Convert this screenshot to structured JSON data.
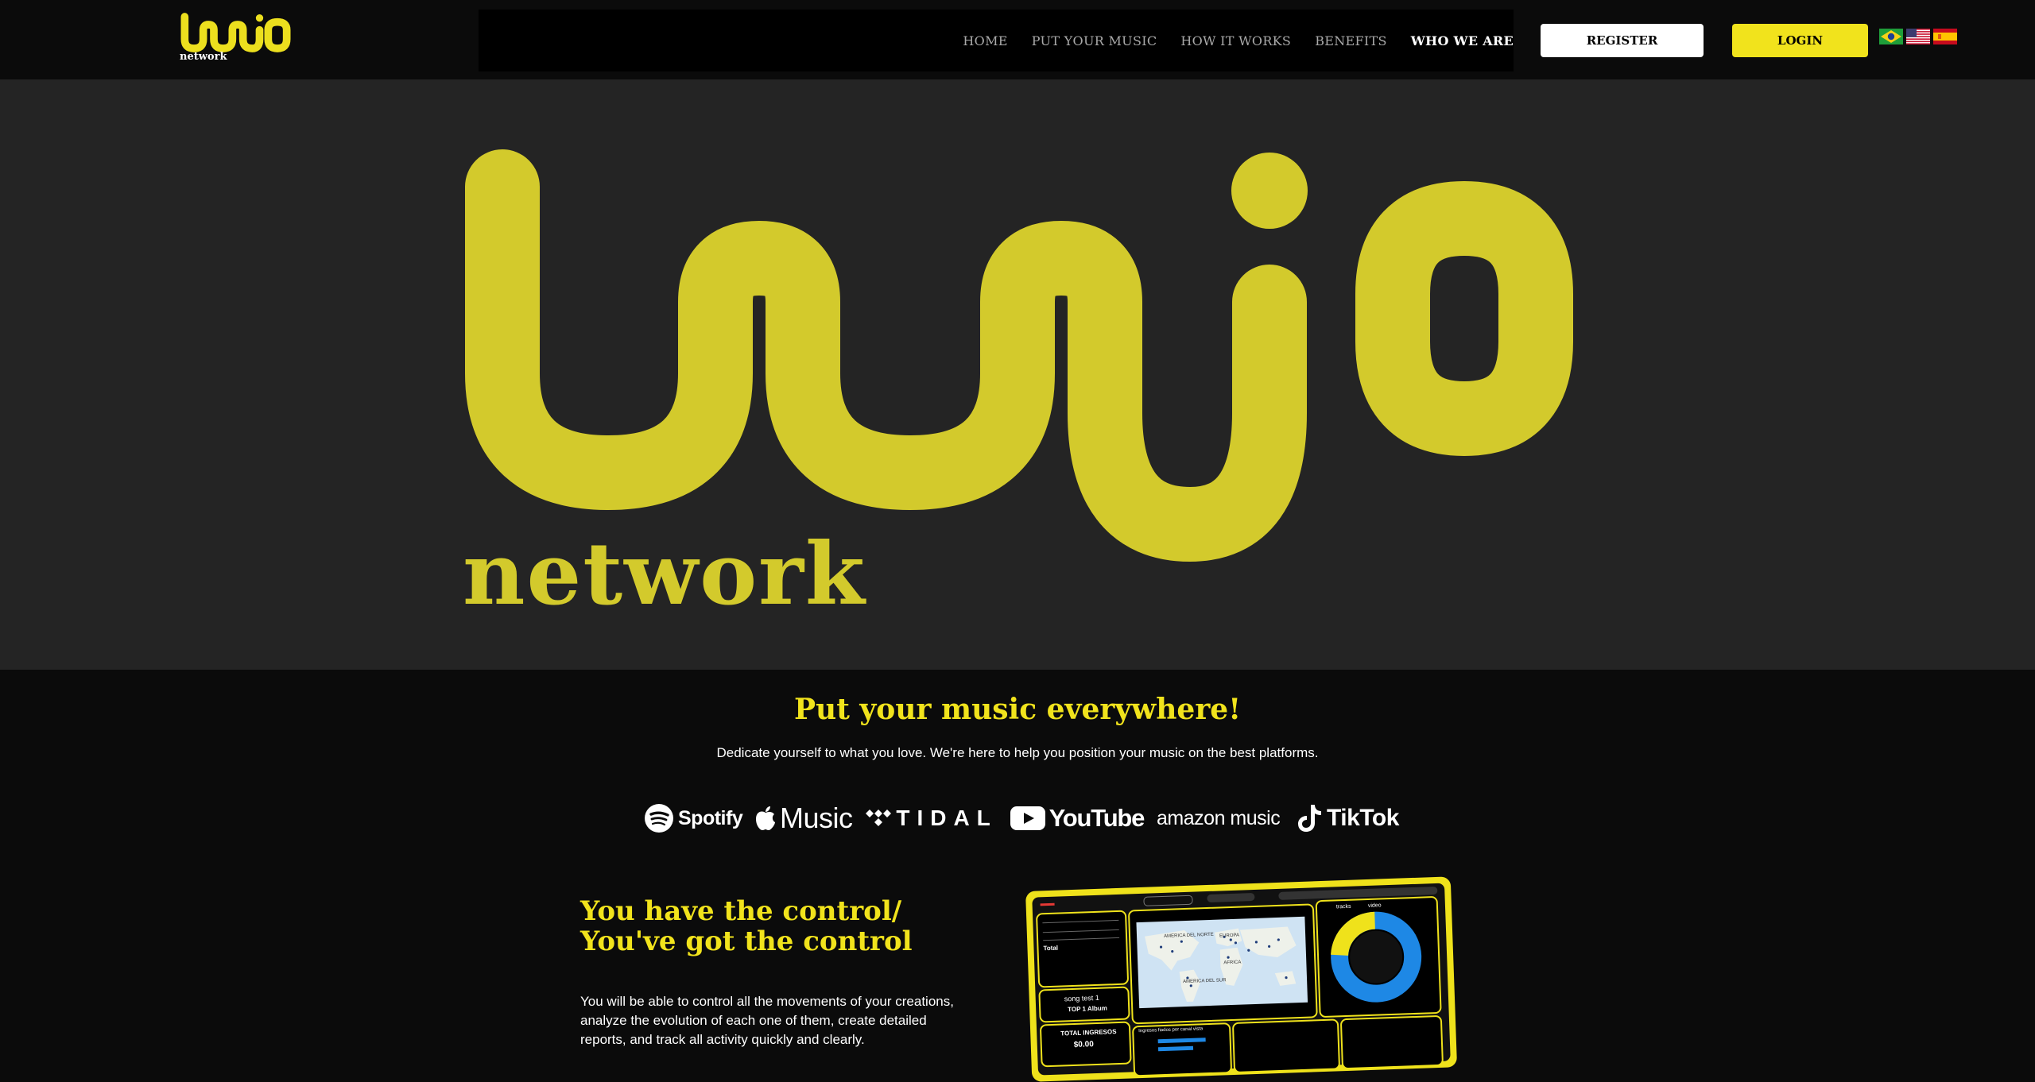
{
  "header": {
    "logo_text": "network",
    "nav": [
      "HOME",
      "PUT YOUR MUSIC",
      "HOW IT WORKS",
      "BENEFITS",
      "WHO WE ARE"
    ],
    "active_nav": "WHO WE ARE",
    "register_label": "REGISTER",
    "login_label": "LOGIN",
    "languages": [
      "brazil-flag-icon",
      "usa-flag-icon",
      "spain-flag-icon"
    ]
  },
  "hero": {
    "logo_word": "network",
    "colors": {
      "logo": "#d3ca2c",
      "background": "#242424"
    }
  },
  "platforms_section": {
    "title": "Put your music everywhere!",
    "subtitle": "Dedicate yourself to what you love. We're here to help you position your music on the best platforms.",
    "platforms": [
      {
        "icon": "spotify-icon",
        "label": "Spotify"
      },
      {
        "icon": "apple-icon",
        "label": "Music"
      },
      {
        "icon": "tidal-icon",
        "label": "TIDAL"
      },
      {
        "icon": "youtube-icon",
        "label": "YouTube"
      },
      {
        "icon": "amazon-smile-icon",
        "label": "amazon music"
      },
      {
        "icon": "tiktok-icon",
        "label": "TikTok"
      }
    ]
  },
  "control_section": {
    "title": "You have the control/ You've got the control",
    "body": "You will be able to control all the movements of your creations, analyze the evolution of each one of them, create detailed reports, and track all activity quickly and clearly."
  },
  "dashboard": {
    "top_card": {
      "title": "song test 1",
      "subtitle": "TOP 1 Album"
    },
    "income_card": {
      "title": "TOTAL INGRESOS",
      "value": "$0.00"
    },
    "table_total_label": "Total",
    "map_labels": [
      "AMERICA DEL NORTE",
      "EUROPA",
      "AFRICA",
      "AMERICA DEL SUR"
    ],
    "chart_title": "Ingresos fiados por canal vista",
    "legend": [
      "tracks",
      "video"
    ],
    "colors": {
      "frame": "#efe21b",
      "accent": "#1e88e5"
    }
  }
}
